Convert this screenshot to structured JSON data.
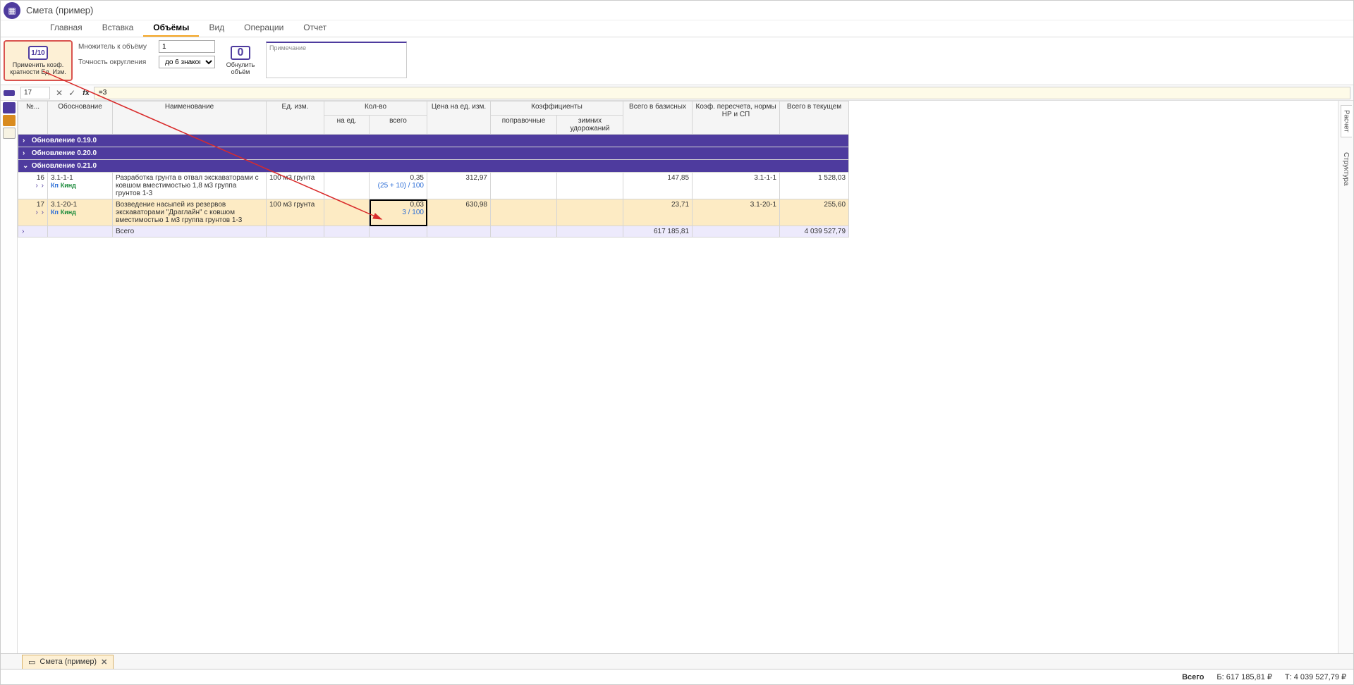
{
  "title": "Смета (пример)",
  "menu": {
    "items": [
      "Главная",
      "Вставка",
      "Объёмы",
      "Вид",
      "Операции",
      "Отчет"
    ],
    "active": "Объёмы"
  },
  "ribbon": {
    "apply_coef_icon": "1/10",
    "apply_coef_label": "Применить коэф. кратности Ед. Изм.",
    "mult_label": "Множитель к объёму",
    "mult_value": "1",
    "round_label": "Точность округления",
    "round_value": "до 6 знаков",
    "zero_icon": "0",
    "zero_label": "Обнулить объём",
    "note_placeholder": "Примечание"
  },
  "formula": {
    "cell_ref": "17",
    "expr": "=3"
  },
  "headers": {
    "num": "№...",
    "basis": "Обоснование",
    "name": "Наименование",
    "unit": "Ед. изм.",
    "qty_group": "Кол-во",
    "qty_per": "на ед.",
    "qty_total": "всего",
    "price": "Цена на ед. изм.",
    "coef_group": "Коэффициенты",
    "coef_corr": "поправочные",
    "coef_winter": "зимних удорожаний",
    "total_base": "Всего в базисных",
    "coef_recalc": "Коэф. пересчета, нормы НР и СП",
    "total_cur": "Всего в текущем"
  },
  "groups": {
    "g1": "Обновление 0.19.0",
    "g2": "Обновление 0.20.0",
    "g3": "Обновление 0.21.0"
  },
  "rows": {
    "r16": {
      "num": "16",
      "basis": "3.1-1-1",
      "k1": "Кп",
      "k2": "Кинд",
      "name": "Разработка грунта в отвал экскаваторами с ковшом вместимостью 1,8 м3 группа грунтов 1-3",
      "unit": "100 м3 грунта",
      "qty_total": "0,35",
      "qty_formula": "(25 + 10) / 100",
      "price": "312,97",
      "total_base": "147,85",
      "recalc": "3.1-1-1",
      "total_cur": "1 528,03"
    },
    "r17": {
      "num": "17",
      "basis": "3.1-20-1",
      "k1": "Кп",
      "k2": "Кинд",
      "name": "Возведение насыпей из резервов экскаваторами \"Драглайн\" с ковшом вместимостью 1 м3 группа грунтов 1-3",
      "unit": "100 м3 грунта",
      "qty_total": "0,03",
      "qty_formula": "3 / 100",
      "price": "630,98",
      "total_base": "23,71",
      "recalc": "3.1-20-1",
      "total_cur": "255,60"
    },
    "total": {
      "name": "Всего",
      "total_base": "617 185,81",
      "total_cur": "4 039 527,79"
    }
  },
  "right_tabs": {
    "t1": "Расчет",
    "t2": "Структура"
  },
  "bottom_tab": "Смета (пример)",
  "status": {
    "total_label": "Всего",
    "base": "Б: 617 185,81 ₽",
    "cur": "Т: 4 039 527,79 ₽"
  }
}
